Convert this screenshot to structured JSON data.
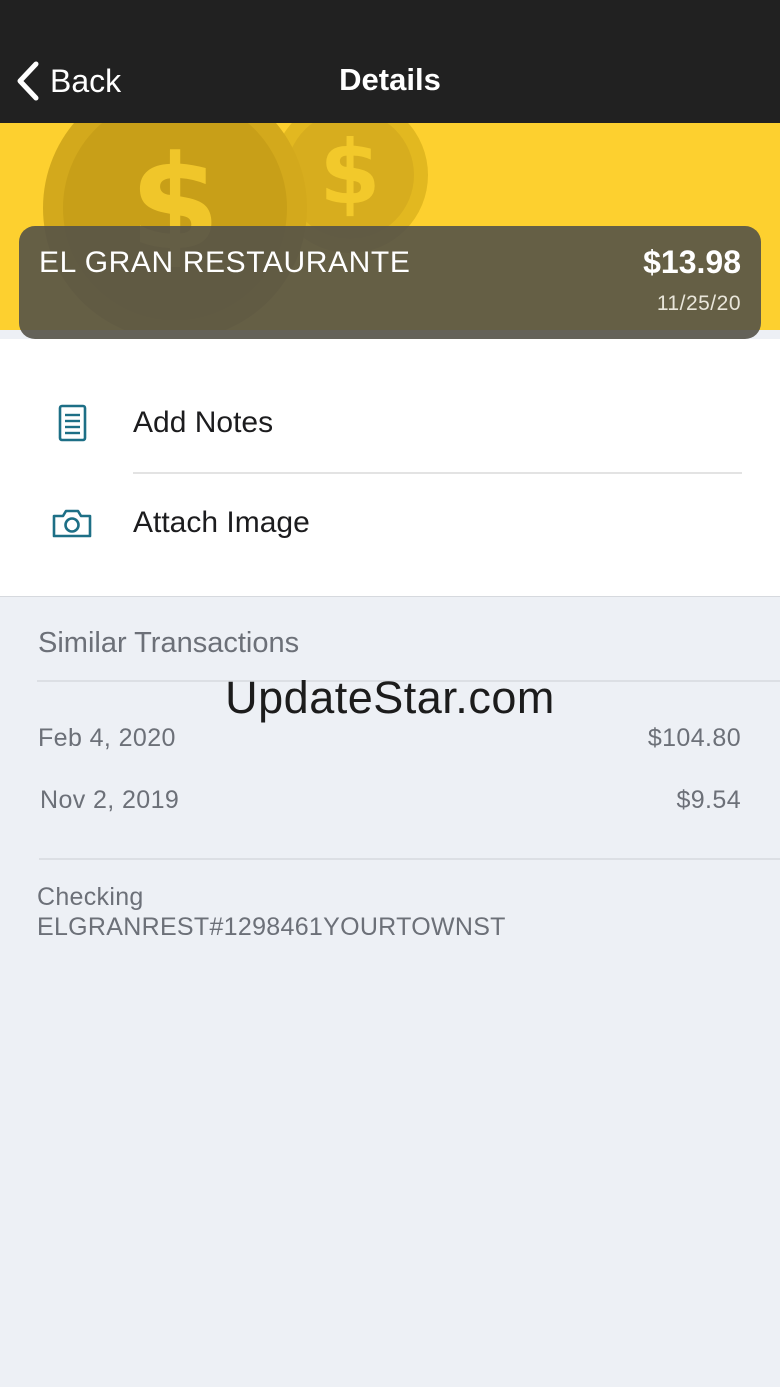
{
  "nav": {
    "back_label": "Back",
    "title": "Details"
  },
  "transaction": {
    "merchant": "EL GRAN RESTAURANTE",
    "amount": "$13.98",
    "date": "11/25/20"
  },
  "actions": [
    {
      "label": "Add Notes",
      "icon": "notes-icon"
    },
    {
      "label": "Attach Image",
      "icon": "camera-icon"
    }
  ],
  "similar": {
    "title": "Similar Transactions",
    "items": [
      {
        "date": "Feb 4, 2020",
        "amount": "$104.80"
      },
      {
        "date": "Nov 2, 2019",
        "amount": "$9.54"
      }
    ]
  },
  "account": {
    "name": "Checking",
    "description": "ELGRANREST#1298461YOURTOWNST"
  },
  "watermark": "UpdateStar.com",
  "colors": {
    "navbar": "#212121",
    "banner": "#fdd02f",
    "icon_teal": "#1d6f86",
    "background": "#edf0f5"
  }
}
